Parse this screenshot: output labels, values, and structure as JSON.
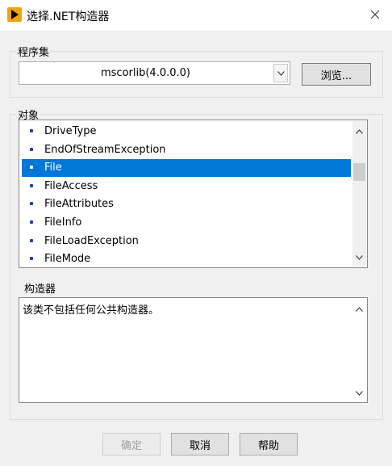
{
  "window": {
    "title": "选择.NET构造器",
    "icon": "labview-run-arrow-icon",
    "accent_color": "#0078d7"
  },
  "assembly": {
    "label": "程序集",
    "selected": "mscorlib(4.0.0.0)",
    "browse_label": "浏览..."
  },
  "objects": {
    "label": "对象",
    "items": [
      {
        "name": "DriveType"
      },
      {
        "name": "EndOfStreamException"
      },
      {
        "name": "File",
        "selected": true
      },
      {
        "name": "FileAccess"
      },
      {
        "name": "FileAttributes"
      },
      {
        "name": "FileInfo"
      },
      {
        "name": "FileLoadException"
      },
      {
        "name": "FileMode"
      }
    ],
    "scroll_position": 0.32
  },
  "constructors": {
    "label": "构造器",
    "text": "该类不包括任何公共构造器。"
  },
  "buttons": {
    "ok": "确定",
    "cancel": "取消",
    "help": "帮助"
  }
}
